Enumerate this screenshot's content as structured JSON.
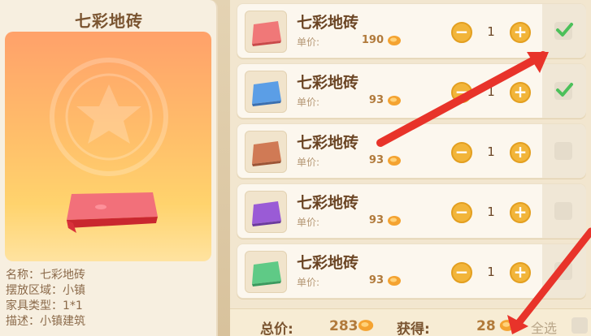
{
  "detail": {
    "title": "七彩地砖",
    "tile_color": "#f2707a",
    "info": [
      "名称：七彩地砖",
      "摆放区域：小镇",
      "家具类型：1*1",
      "描述：小镇建筑"
    ]
  },
  "items": [
    {
      "name": "七彩地砖",
      "price_label": "单价:",
      "price": "190",
      "qty": "1",
      "checked": true,
      "color": "#f07878",
      "icon": "tile-icon"
    },
    {
      "name": "七彩地砖",
      "price_label": "单价:",
      "price": "93",
      "qty": "1",
      "checked": true,
      "color": "#5b9ee6",
      "icon": "tile-icon"
    },
    {
      "name": "七彩地砖",
      "price_label": "单价:",
      "price": "93",
      "qty": "1",
      "checked": false,
      "color": "#d07a55",
      "icon": "tile-icon"
    },
    {
      "name": "七彩地砖",
      "price_label": "单价:",
      "price": "93",
      "qty": "1",
      "checked": false,
      "color": "#9a5bd6",
      "icon": "tile-icon"
    },
    {
      "name": "七彩地砖",
      "price_label": "单价:",
      "price": "93",
      "qty": "1",
      "checked": false,
      "color": "#5fca86",
      "icon": "tile-icon"
    }
  ],
  "stepper": {
    "minus": "−",
    "plus": "+"
  },
  "footer": {
    "total_label": "总价:",
    "total_value": "283",
    "gain_label": "获得:",
    "gain_value": "28",
    "select_all": "全选"
  },
  "colors": {
    "accent_orange": "#f2b53a",
    "check_green": "#4cc05a",
    "arrow_red": "#e8332a"
  }
}
